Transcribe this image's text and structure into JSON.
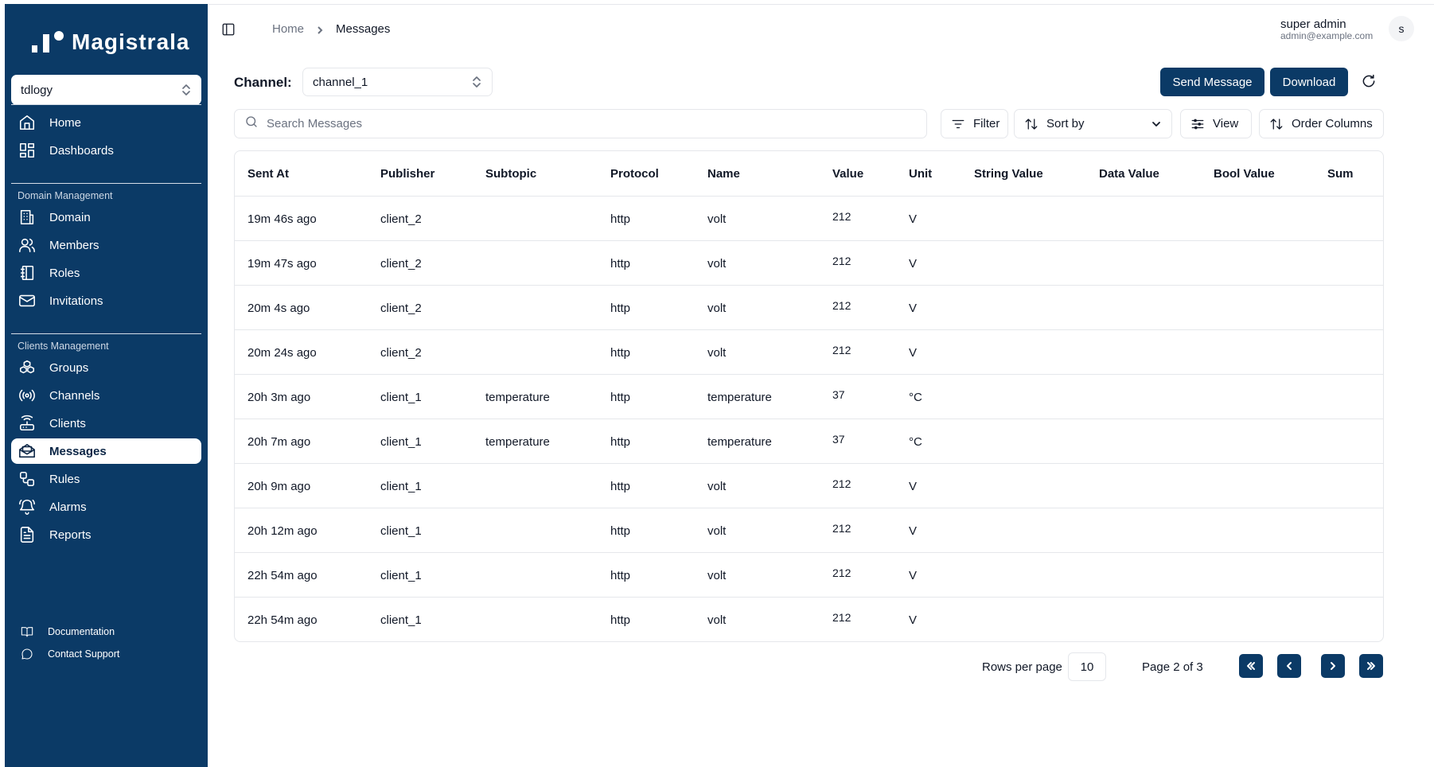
{
  "app": {
    "brand": "Magistrala"
  },
  "sidebar": {
    "domain_select": "tdlogy",
    "top_items": [
      {
        "label": "Home",
        "icon": "home-icon"
      },
      {
        "label": "Dashboards",
        "icon": "dashboard-icon"
      }
    ],
    "domain_section": {
      "title": "Domain Management",
      "items": [
        {
          "label": "Domain",
          "icon": "building-icon"
        },
        {
          "label": "Members",
          "icon": "users-icon"
        },
        {
          "label": "Roles",
          "icon": "book-icon"
        },
        {
          "label": "Invitations",
          "icon": "mail-icon"
        }
      ]
    },
    "clients_section": {
      "title": "Clients Management",
      "items": [
        {
          "label": "Groups",
          "icon": "boxes-icon"
        },
        {
          "label": "Channels",
          "icon": "radio-icon"
        },
        {
          "label": "Clients",
          "icon": "router-icon"
        },
        {
          "label": "Messages",
          "icon": "mail-open-icon",
          "active": true
        },
        {
          "label": "Rules",
          "icon": "workflow-icon"
        },
        {
          "label": "Alarms",
          "icon": "bell-ring-icon"
        },
        {
          "label": "Reports",
          "icon": "file-text-icon"
        }
      ]
    },
    "footer": [
      {
        "label": "Documentation",
        "icon": "book-open-icon"
      },
      {
        "label": "Contact Support",
        "icon": "message-circle-icon"
      }
    ]
  },
  "header": {
    "breadcrumb": {
      "home": "Home",
      "current": "Messages"
    },
    "user": {
      "name": "super admin",
      "email": "admin@example.com",
      "avatar_initial": "s"
    }
  },
  "channel": {
    "label": "Channel:",
    "value": "channel_1",
    "send_label": "Send Message",
    "download_label": "Download"
  },
  "toolbar": {
    "search_placeholder": "Search Messages",
    "filter_label": "Filter",
    "sort_label": "Sort by",
    "view_label": "View",
    "order_label": "Order Columns"
  },
  "table": {
    "columns": [
      "Sent At",
      "Publisher",
      "Subtopic",
      "Protocol",
      "Name",
      "Value",
      "Unit",
      "String Value",
      "Data Value",
      "Bool Value",
      "Sum"
    ],
    "rows": [
      [
        "19m 46s ago",
        "client_2",
        "",
        "http",
        "volt",
        "212",
        "V",
        "",
        "",
        "",
        ""
      ],
      [
        "19m 47s ago",
        "client_2",
        "",
        "http",
        "volt",
        "212",
        "V",
        "",
        "",
        "",
        ""
      ],
      [
        "20m 4s ago",
        "client_2",
        "",
        "http",
        "volt",
        "212",
        "V",
        "",
        "",
        "",
        ""
      ],
      [
        "20m 24s ago",
        "client_2",
        "",
        "http",
        "volt",
        "212",
        "V",
        "",
        "",
        "",
        ""
      ],
      [
        "20h 3m ago",
        "client_1",
        "temperature",
        "http",
        "temperature",
        "37",
        "°C",
        "",
        "",
        "",
        ""
      ],
      [
        "20h 7m ago",
        "client_1",
        "temperature",
        "http",
        "temperature",
        "37",
        "°C",
        "",
        "",
        "",
        ""
      ],
      [
        "20h 9m ago",
        "client_1",
        "",
        "http",
        "volt",
        "212",
        "V",
        "",
        "",
        "",
        ""
      ],
      [
        "20h 12m ago",
        "client_1",
        "",
        "http",
        "volt",
        "212",
        "V",
        "",
        "",
        "",
        ""
      ],
      [
        "22h 54m ago",
        "client_1",
        "",
        "http",
        "volt",
        "212",
        "V",
        "",
        "",
        "",
        ""
      ],
      [
        "22h 54m ago",
        "client_1",
        "",
        "http",
        "volt",
        "212",
        "V",
        "",
        "",
        "",
        ""
      ]
    ]
  },
  "pagination": {
    "rows_label": "Rows per page",
    "rows_value": "10",
    "page_label": "Page 2 of 3"
  },
  "colors": {
    "sidebar": "#0b3a66",
    "primary_button": "#0b3a66",
    "border": "#e5e7eb"
  }
}
